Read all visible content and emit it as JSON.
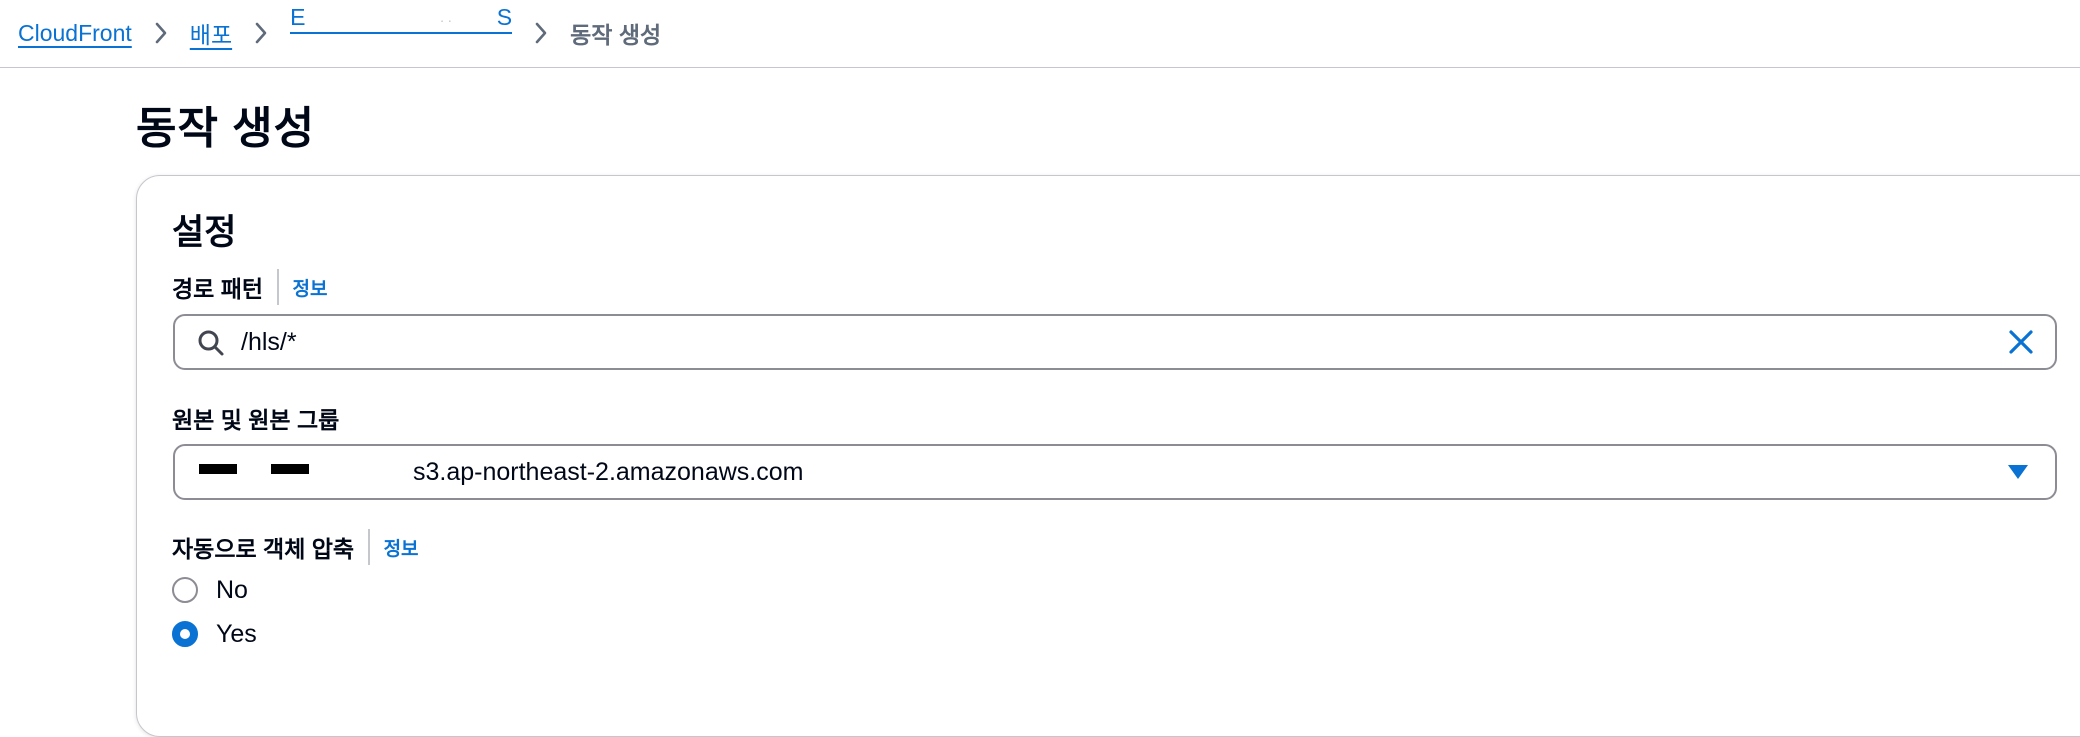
{
  "breadcrumb": {
    "items": [
      "CloudFront",
      "배포"
    ],
    "distribution_start": "E",
    "distribution_end": "S",
    "distribution_dots": ". .",
    "current": "동작 생성"
  },
  "page": {
    "title": "동작 생성"
  },
  "settings": {
    "title": "설정",
    "path_pattern": {
      "label": "경로 패턴",
      "info": "정보",
      "value": "/hls/*"
    },
    "origin": {
      "label": "원본 및 원본 그룹",
      "value": "s3.ap-northeast-2.amazonaws.com"
    },
    "compress": {
      "label": "자동으로 객체 압축",
      "info": "정보",
      "options": [
        "No",
        "Yes"
      ],
      "selected": "Yes"
    }
  },
  "colors": {
    "link": "#0972d3",
    "border": "#8c8c94",
    "text": "#000716",
    "muted": "#5f6b7a"
  },
  "icons": [
    "chevron-right-icon",
    "search-icon",
    "close-icon",
    "caret-down-icon"
  ]
}
